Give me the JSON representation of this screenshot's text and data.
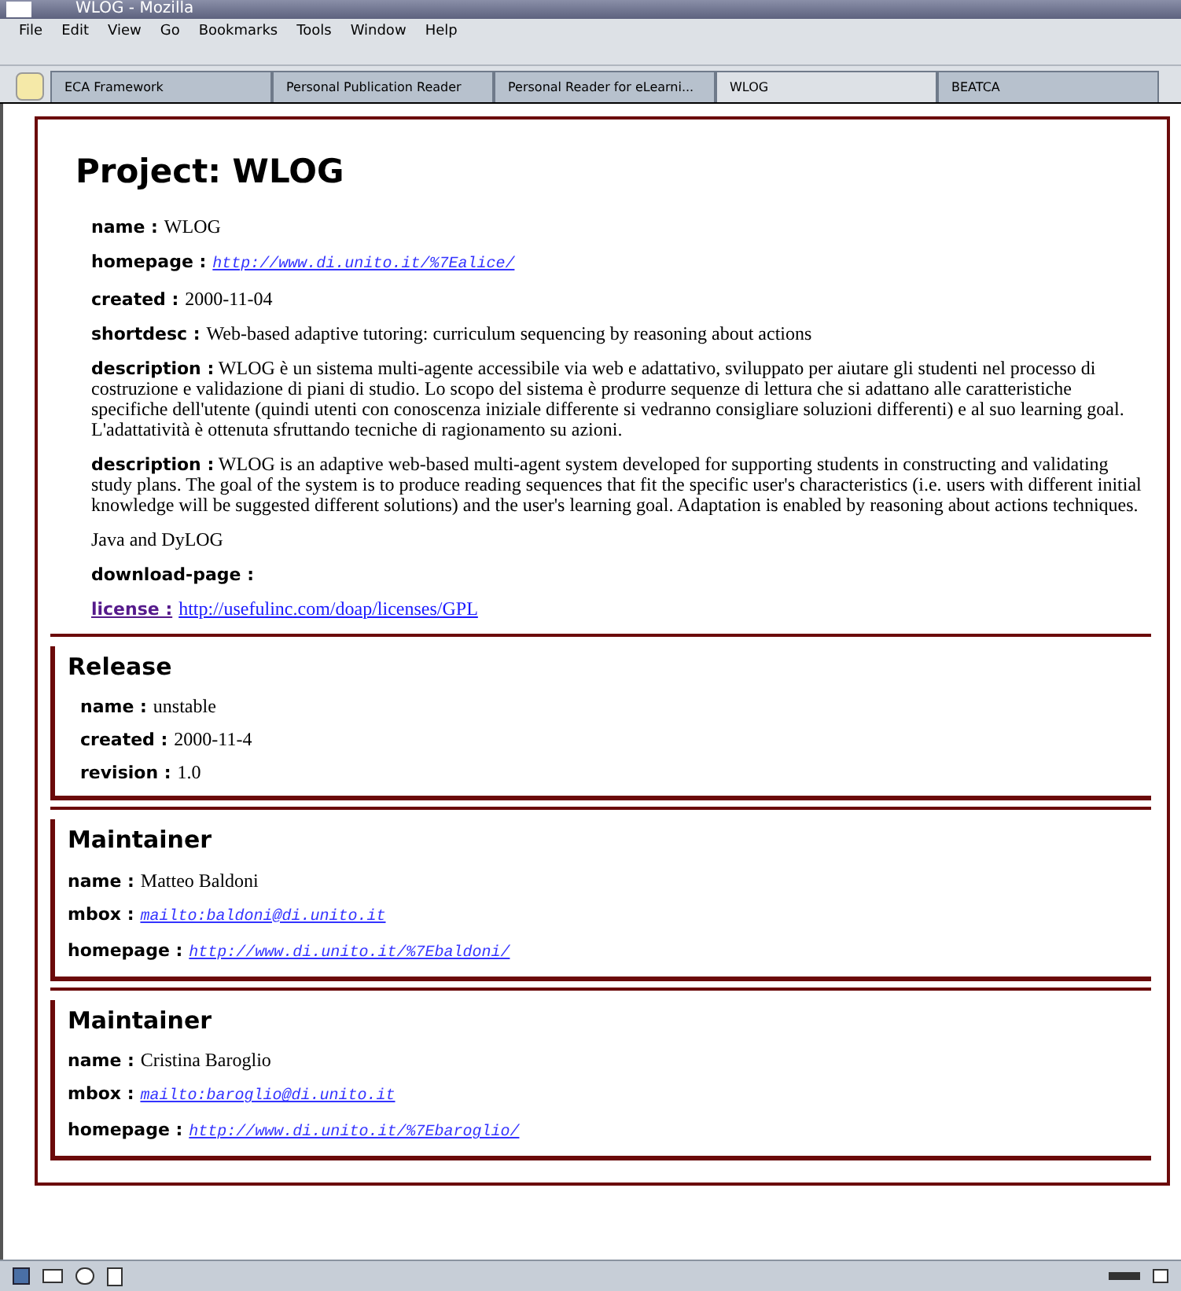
{
  "window": {
    "title": "WLOG - Mozilla"
  },
  "menu": [
    "File",
    "Edit",
    "View",
    "Go",
    "Bookmarks",
    "Tools",
    "Window",
    "Help"
  ],
  "tabs": [
    {
      "label": "ECA Framework",
      "selected": false
    },
    {
      "label": "Personal Publication Reader",
      "selected": false
    },
    {
      "label": "Personal Reader for eLearni...",
      "selected": false
    },
    {
      "label": "WLOG",
      "selected": true
    },
    {
      "label": "BEATCA",
      "selected": false
    }
  ],
  "project": {
    "title": "Project: WLOG",
    "fields": [
      {
        "kind": "text",
        "label": "name :",
        "value": "WLOG"
      },
      {
        "kind": "url",
        "label": "homepage :",
        "value": "http://www.di.unito.it/%7Ealice/"
      },
      {
        "kind": "text",
        "label": "created :",
        "value": "2000-11-04"
      },
      {
        "kind": "text",
        "label": "shortdesc :",
        "value": "Web-based adaptive tutoring: curriculum sequencing by reasoning about actions"
      },
      {
        "kind": "text",
        "label": "description :",
        "value": "WLOG è un sistema multi-agente accessibile via web e adattativo, sviluppato per aiutare gli studenti nel processo di costruzione e validazione di piani di studio. Lo scopo del sistema è produrre sequenze di lettura che si adattano alle caratteristiche specifiche dell'utente (quindi utenti con conoscenza iniziale differente si vedranno consigliare soluzioni differenti) e al suo learning goal. L'adattatività è ottenuta sfruttando tecniche di ragionamento su azioni."
      },
      {
        "kind": "text",
        "label": "description :",
        "value": "WLOG is an adaptive web-based multi-agent system developed for supporting students in constructing and validating study plans. The goal of the system is to produce reading sequences that fit the specific user's characteristics (i.e. users with different initial knowledge will be suggested different solutions) and the user's learning goal. Adaptation is enabled by reasoning about actions techniques."
      },
      {
        "kind": "plain",
        "value": "Java and DyLOG"
      },
      {
        "kind": "text",
        "label": "download-page :"
      },
      {
        "kind": "link",
        "label": "license :",
        "value": "http://usefulinc.com/doap/licenses/GPL"
      }
    ]
  },
  "sections": [
    {
      "title": "Release",
      "indented": true,
      "fields": [
        {
          "kind": "text",
          "label": "name :",
          "value": "unstable"
        },
        {
          "kind": "text",
          "label": "created :",
          "value": "2000-11-4"
        },
        {
          "kind": "text",
          "label": "revision :",
          "value": "1.0"
        }
      ]
    },
    {
      "title": "Maintainer",
      "indented": false,
      "fields": [
        {
          "kind": "text",
          "label": "name :",
          "value": "Matteo Baldoni"
        },
        {
          "kind": "url",
          "label": "mbox :",
          "value": "mailto:baldoni@di.unito.it"
        },
        {
          "kind": "url",
          "label": "homepage :",
          "value": "http://www.di.unito.it/%7Ebaldoni/"
        }
      ]
    },
    {
      "title": "Maintainer",
      "indented": false,
      "fields": [
        {
          "kind": "text",
          "label": "name :",
          "value": "Cristina Baroglio"
        },
        {
          "kind": "url",
          "label": "mbox :",
          "value": "mailto:baroglio@di.unito.it"
        },
        {
          "kind": "url",
          "label": "homepage :",
          "value": "http://www.di.unito.it/%7Ebaroglio/"
        }
      ]
    }
  ]
}
